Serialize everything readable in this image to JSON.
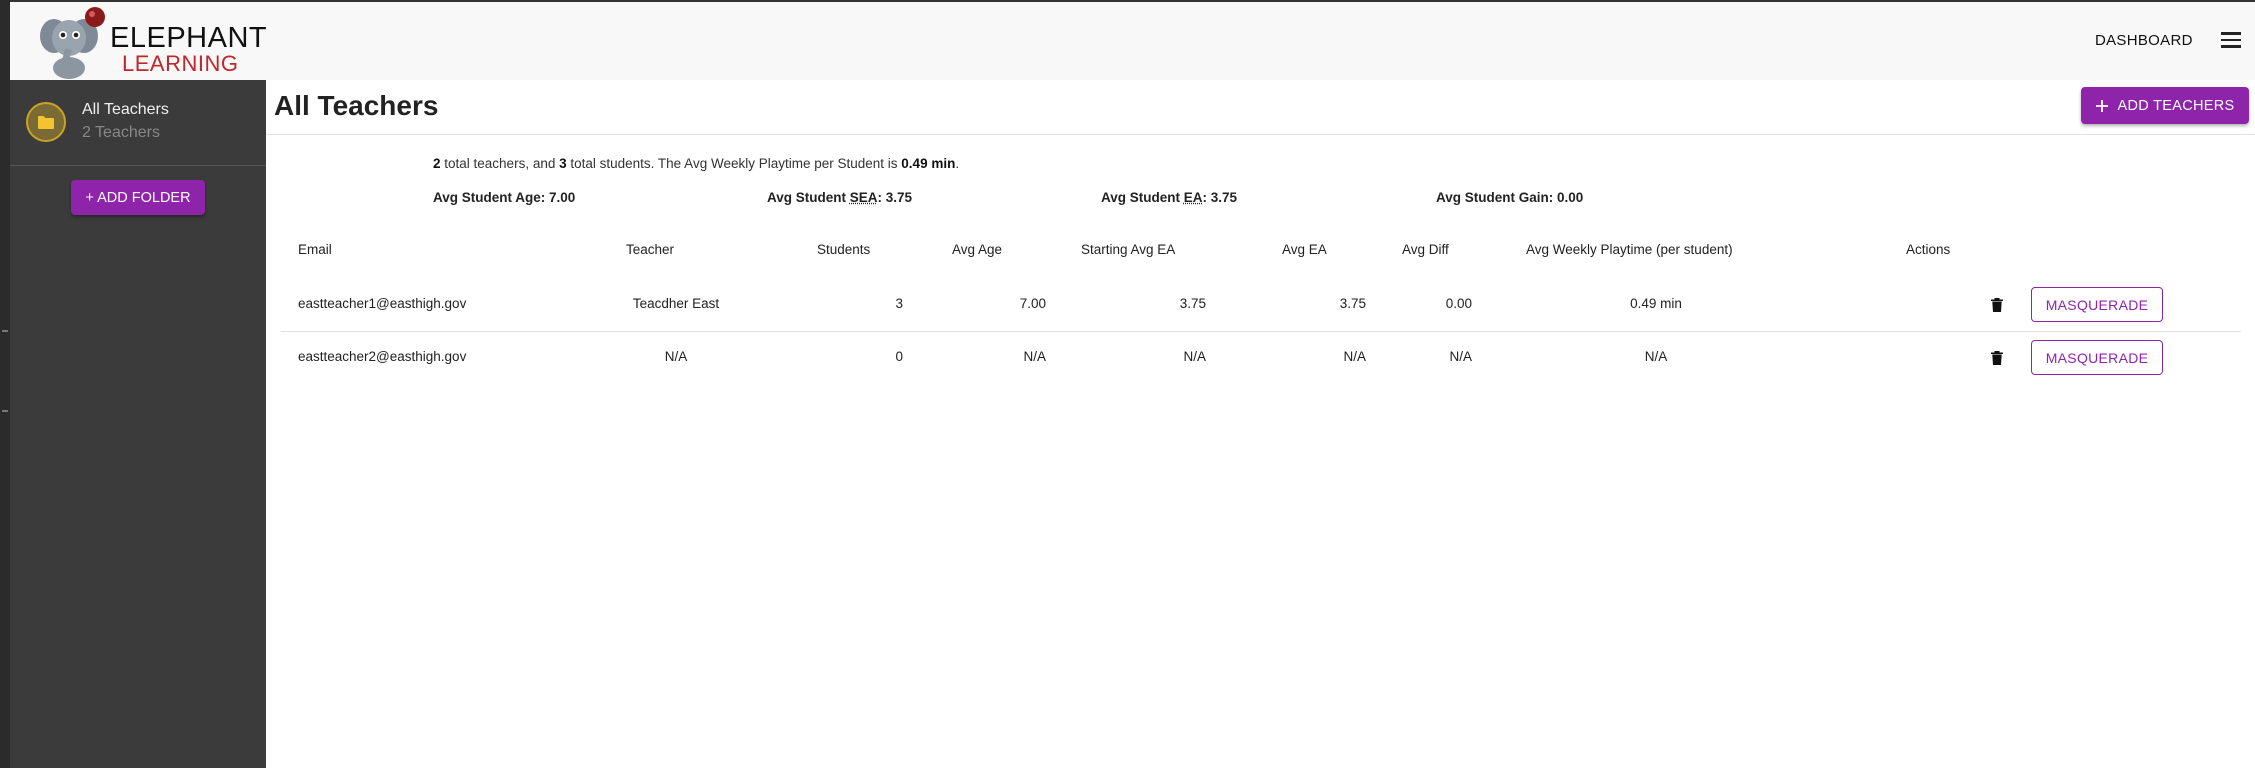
{
  "brand": {
    "line1": "ELEPHANT",
    "line2": "LEARNING"
  },
  "nav": {
    "dashboard": "DASHBOARD"
  },
  "sidebar": {
    "folder": {
      "title": "All Teachers",
      "subtitle": "2 Teachers"
    },
    "add_folder": "+ ADD FOLDER"
  },
  "page": {
    "title": "All Teachers",
    "add_teachers": "ADD TEACHERS"
  },
  "summary": {
    "teachers_count": "2",
    "text1": " total teachers, and ",
    "students_count": "3",
    "text2": " total students. The Avg Weekly Playtime per Student is ",
    "playtime": "0.49 min",
    "text3": "."
  },
  "stats": {
    "age_label": "Avg Student Age: ",
    "age_value": "7.00",
    "sea_pre": "Avg Student ",
    "sea_abbr": "SEA",
    "sea_value": ": 3.75",
    "ea_pre": "Avg Student ",
    "ea_abbr": "EA",
    "ea_value": ": 3.75",
    "gain_label": "Avg Student Gain: ",
    "gain_value": "0.00"
  },
  "table": {
    "headers": [
      "Email",
      "Teacher",
      "Students",
      "Avg Age",
      "Starting Avg EA",
      "Avg EA",
      "Avg Diff",
      "Avg Weekly Playtime (per student)",
      "Actions"
    ],
    "rows": [
      [
        "eastteacher1@easthigh.gov",
        "Teacdher East",
        "3",
        "7.00",
        "3.75",
        "3.75",
        "0.00",
        "0.49 min"
      ],
      [
        "eastteacher2@easthigh.gov",
        "N/A",
        "0",
        "N/A",
        "N/A",
        "N/A",
        "N/A",
        "N/A"
      ]
    ],
    "action_label": "MASQUERADE"
  },
  "colors": {
    "accent": "#8e24aa",
    "sidebar": "#3b3b3b",
    "brand_red": "#c0272d"
  }
}
